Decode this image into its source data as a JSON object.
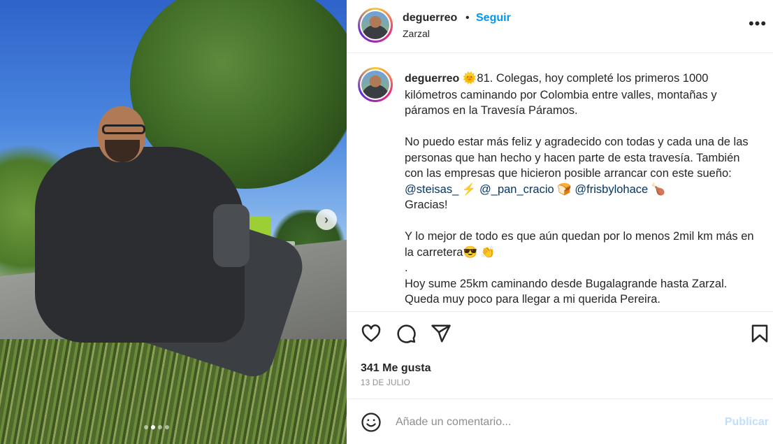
{
  "header": {
    "username": "deguerreo",
    "separator": "•",
    "follow_label": "Seguir",
    "location": "Zarzal",
    "more_label": "•••"
  },
  "caption": {
    "username": "deguerreo",
    "sun_emoji": "🌞",
    "p1": "81. Colegas, hoy completé los primeros 1000 kilómetros caminando por Colombia entre valles, montañas y páramos en la Travesía Páramos.",
    "p2_before": "No puedo estar más feliz y agradecido con todas y cada una de las personas que han hecho y hacen parte de esta travesía. También con las empresas que hicieron posible arrancar con este sueño: ",
    "mention1": "@steisas_",
    "emoji1": "⚡",
    "mention2": "@_pan_cracio",
    "emoji2": "🍞",
    "mention3": "@frisbylohace",
    "emoji3": "🍗",
    "p2_after": "Gracias!",
    "p3": "Y lo mejor de todo es que aún quedan por lo menos 2mil km más en la carretera",
    "emoji4": "😎",
    "emoji5": "👏",
    "dot": ".",
    "p4": "Hoy sume 25km caminando desde Bugalagrande hasta Zarzal. Queda muy poco para llegar a mi querida Pereira."
  },
  "photo": {
    "next_label": "›",
    "carousel_dots": 4,
    "active_dot": 1
  },
  "actions": {
    "icons": [
      "heart-icon",
      "comment-icon",
      "share-icon",
      "bookmark-icon"
    ],
    "likes": "341 Me gusta",
    "date": "13 DE JULIO"
  },
  "comment": {
    "placeholder": "Añade un comentario...",
    "publish_label": "Publicar",
    "emoji_icon": "smiley-icon"
  },
  "colors": {
    "accent": "#0095f6",
    "mention": "#00376b",
    "publish_disabled": "#c0dffd",
    "muted": "#8e8e8e"
  }
}
